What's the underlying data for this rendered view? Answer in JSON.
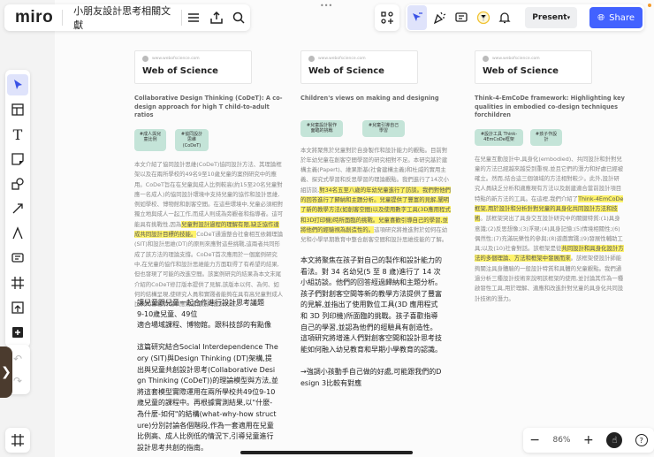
{
  "app": {
    "logo": "miro",
    "board_title": "小朋友設計思考相關文獻",
    "menu_dots": "•••"
  },
  "toolbar": {
    "present_label": "Present",
    "share_label": "Share",
    "accent": "#4262ff"
  },
  "left_tools": [
    "select",
    "templates",
    "text",
    "sticky-note",
    "shapes",
    "arrow",
    "pen",
    "comment",
    "frame",
    "upload",
    "more"
  ],
  "zoom": {
    "minus": "−",
    "level": "86%",
    "plus": "+",
    "help": "?"
  },
  "columns": [
    {
      "card": {
        "url": "www.webofscience.com",
        "name": "Web of Science"
      },
      "title": "Collaborative Design Thinking (CoDeT): A co-design approach for high T child-to-adult ratios",
      "tags": [
        "#成人與兒童比例",
        "#協同設計思維(CoDeT)"
      ],
      "body": [
        {
          "text": "本文介紹了協同設計思維(CoDeT)協同設計方法、其理論框架以及在兩所學校的49名9至10歲兒童的案例研究中的應用。CoDeT旨在在兒童與成人比例較高(約15至20名兒童對應一名成人)的協同設計環境中支持兒童的協作和設計思維,例如學校、博物館和創客空間。在這些環境中,兒童必須相對獨立地與成人一起工作,而成人則成為旁觀者和指導者。這可能具有挑戰性,因為",
          "highlight": false
        },
        {
          "text": "兒童對設計過程的理解有限,缺乏協作達成共同設計目標的技能。",
          "highlight": true
        },
        {
          "text": "CoDeT通過整合社會相互依賴理論(SIT)和設計思維(DT)的原則來應對這些挑戰,這兩者共同形成了該方法的理論支撐。CoDeT首次應用於一個案例研究中,在兒童的協作和設計思維能力方面取得了有希望的結果,但也發現了可能的改進空間。該案例研究的結果為本文末尾介紹的CoDeT修訂版本提供了見解,該版本以何、為何、如何的結構呈現,使研究人員和實踐者能夠在具有高兒童對成人比例的各種情境中應用這種協同設計方法。",
          "highlight": false
        }
      ],
      "note": "讓兒童跟兒童一起合作進行設計思考議題\n9-10歲兒童、49位\n適合場域課程、博物館。跟科技部的有點像\n\n這篇研究結合Social Interdependence Theory (SIT)與Design Thinking (DT)架構,提出與兒童共創設計思考(Collaborative Design Thinking (CoDeT))的理論模型與方法,並將這套模型實際運用在兩所學校共49位9-10歲兒童的課程中。再根據實測結果,以\"什麼-為什麼-如何\"的結構(what-why-how structure)分別討論各個階段,作為一套適用在兒童比例高、成人比例低的情況下,引導兒童進行設計思考共創的指南。"
    },
    {
      "card": {
        "url": "www.webofscience.com",
        "name": "Web of Science"
      },
      "title": "Children's views on making and designing",
      "tags": [
        "#兒童設計製作面臨的挑戰",
        "#兒童引導自己學習"
      ],
      "body": [
        {
          "text": "本文將聚焦於兒童對於自身製作和設計能力的觀點。目前對於年幼兒童在創客空間學習的研究相對不足。本研究基於建構主義(Papert)、維果斯基(社會建構主義)和杜威的實用主義、探究式學習和反思學習的理論觀點。我們進行了14次小組訪談,",
          "highlight": false
        },
        {
          "text": "對34名五至八歲的年幼兒童進行了訪談。我們對他們的回答進行了歸納和主題分析。兒童提供了豐富的見解,闡明了新的教學方法(如創客空間)以及使用數字工具(3D應用程式和3D打印機)時所面臨的挑戰。兒童喜歡引導自己的學習,並將他們的經驗視為創造性的。",
          "highlight": true
        },
        {
          "text": "這項研究將推進對於如何在幼兒和小學早期教育中整合創客空間和設計思維技能的了解。",
          "highlight": false
        }
      ],
      "note": "本文將聚焦在孩子對自己的製作和設計能力的看法。對 34 名幼兒(5 至 8 歲)進行了 14 次小組訪談。他們的回答經過歸納和主題分析。孩子們對創客空間等新的教學方法提供了豐富的見解,並指出了使用數位工具(3D 應用程式和 3D 列印機)所面臨的挑戰。孩子喜歡指導自己的學習,並認為他們的經驗具有創造性。這項研究將增進人們對創客空間和設計思考技能如何融入幼兒教育和早期小學教育的認識。\n\n→強調小孩動手自己做的好處,可能跟我們的Design 3比較有對應"
    },
    {
      "card": {
        "url": "www.webofscience.com",
        "name": "Web of Science"
      },
      "title": "Think-4-EmCoDe framework: Highlighting key qualities in embodied co-design techniques forchildren",
      "tags": [
        "#設計工具 Think-4EmCoDe框架",
        "#孩子作設計"
      ],
      "body": [
        {
          "text": "在兒童互動設計中,具身化(embodied)、共同設計和針對兒童的方法已經越來越受到重視,並且它們的潛力和好處已經被確立。然而,結合這三個領域的方法相對較少。此外,設計研究人員缺乏分析和適應現有方法以及創建適合當前設計項目特點的新方法的工具。在這裡,我們介紹了",
          "highlight": false
        },
        {
          "text": "Think-4EmCoDe框架,用於設計和分析針對兒童的具身化共同設計方法和技術",
          "highlight": true
        },
        {
          "text": "。該框架突出了具身交互設計研究中的關鍵特質:(1)具身意識;(2)反思想像;(3)浮現;(4)具身記憶;(5)情境相關性;(6)偶然性;(7)充滿玩樂性的參與;(8)遊戲實踐;(9)發展性輔助工具;以及(10)社會對話。該框架是從",
          "highlight": false
        },
        {
          "text": "共同設計和具身化設計方法的多個理論、方法和框架中發展而來",
          "highlight": true
        },
        {
          "text": "。該框架使設計師能夠關注具身體驗的一般設計特質和具體的兒童觀點。我們通過分析三種設計技術來說明該框架的使用,並討論其作為一種啟發性工具,用於理解、適應和改進針對兒童的具身化共同設計技術的潛力。",
          "highlight": false
        }
      ]
    }
  ]
}
